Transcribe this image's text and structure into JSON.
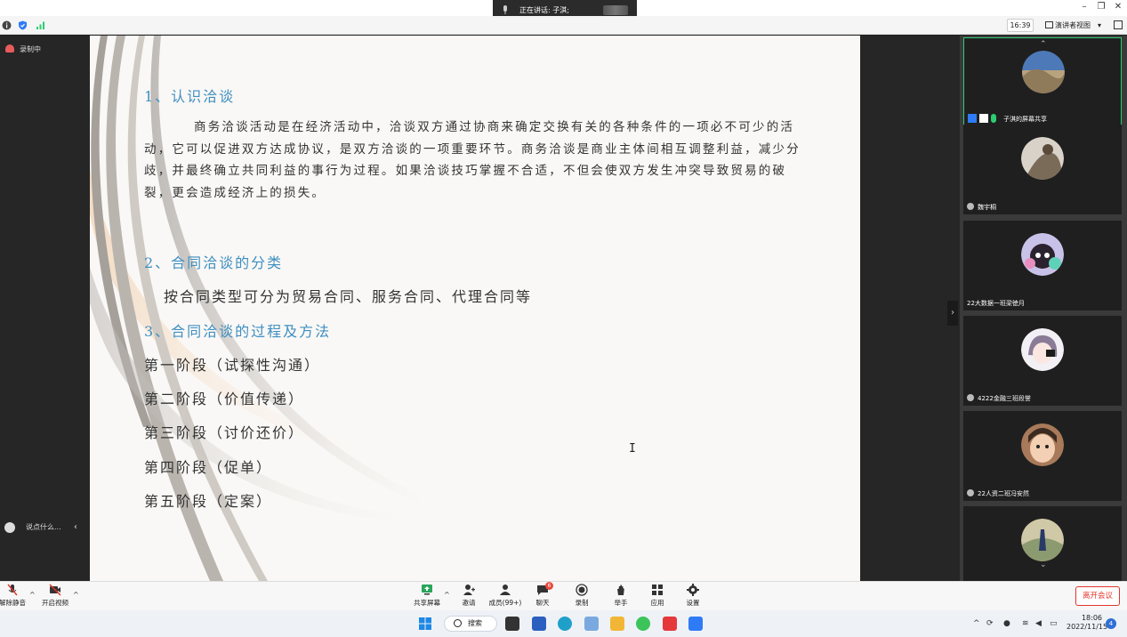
{
  "speaking": {
    "label": "正在讲话: 子淇;"
  },
  "toolbar": {
    "time": "16:39",
    "view_label": "演讲者视图",
    "view_caret": "▾"
  },
  "left_panel": {
    "recording_label": "录制中",
    "chat_placeholder": "说点什么...",
    "collapse_arrow": "‹"
  },
  "slide": {
    "heading1": "1、认识洽谈",
    "paragraph1": "商务洽谈活动是在经济活动中，洽谈双方通过协商来确定交换有关的各种条件的一项必不可少的活动，它可以促进双方达成协议，是双方洽谈的一项重要环节。商务洽谈是商业主体间相互调整利益，减少分歧，并最终确立共同利益的事行为过程。如果洽谈技巧掌握不合适，不但会使双方发生冲突导致贸易的破裂，更会造成经济上的损失。",
    "heading2": "2、合同洽谈的分类",
    "paragraph2": "按合同类型可分为贸易合同、服务合同、代理合同等",
    "heading3": "3、合同洽谈的过程及方法",
    "stages": [
      "第一阶段（试探性沟通）",
      "第二阶段（价值传递）",
      "第三阶段（讨价还价）",
      "第四阶段（促单）",
      "第五阶段（定案）"
    ],
    "cursor": "I"
  },
  "gallery": {
    "toggle": "›",
    "up": "⌃",
    "down": "⌄",
    "tiles": [
      {
        "name": "子淇的屏幕共享"
      },
      {
        "name": "魏宇桐"
      },
      {
        "name": "22大数据一班梁徳月"
      },
      {
        "name": "4222金融三班段誉"
      },
      {
        "name": "22人资二班冯安然"
      },
      {
        "name": ""
      }
    ]
  },
  "controls": {
    "unmute": "解除静音",
    "start_video": "开启视频",
    "share_screen": "共享屏幕",
    "invite": "邀请",
    "members": "成员(99+)",
    "chat": "聊天",
    "chat_badge": "6",
    "record": "录制",
    "raise_hand": "举手",
    "apps": "应用",
    "settings": "设置",
    "leave": "离开会议",
    "caret": "^"
  },
  "taskbar": {
    "search_label": "搜索",
    "tray_up": "^",
    "time": "18:06",
    "date": "2022/11/15",
    "notifications": "4"
  },
  "colors": {
    "accent_blue": "#3e8fc2",
    "leave_red": "#e3352b",
    "active_border": "#2ecc71"
  }
}
